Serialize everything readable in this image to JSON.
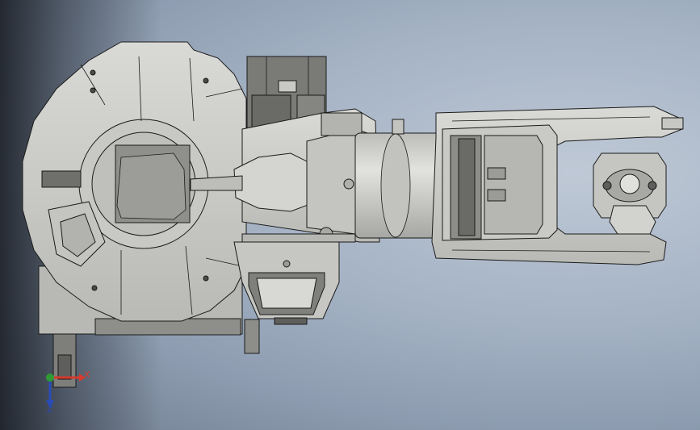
{
  "viewport": {
    "background_top": "#bfc9d6",
    "background_bottom": "#6f7c8e"
  },
  "model": {
    "part_fill": "#cfd0cc",
    "part_shade": "#a7a9a4",
    "dark_fill": "#6b6c69",
    "edge_color": "#1a1a1a"
  },
  "triad": {
    "x_label": "X",
    "z_label": "Z",
    "x_color": "#d63a2e",
    "y_color": "#2f9b34",
    "z_color": "#2b4bb8"
  }
}
